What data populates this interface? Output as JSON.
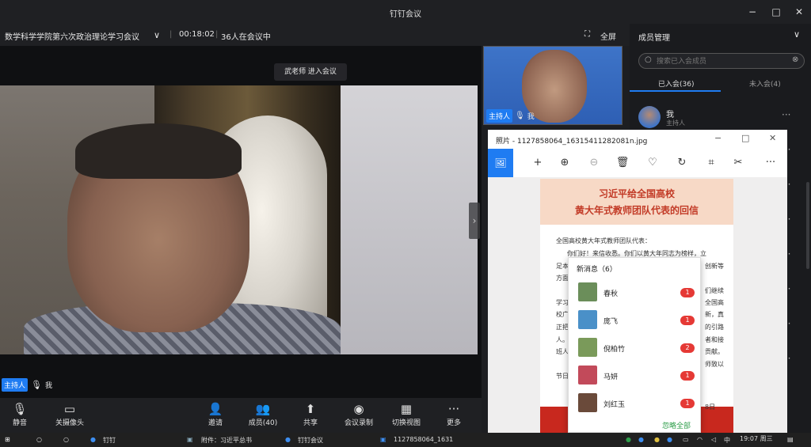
{
  "window": {
    "title": "钉钉会议",
    "min": "−",
    "max": "□",
    "close": "✕"
  },
  "meeting": {
    "name": "数学科学学院第六次政治理论学习会议",
    "duration": "00:18:02",
    "attendee_status": "36人在会议中",
    "fullscreen": "全屏"
  },
  "toast": "武老师 进入会议",
  "self_label": {
    "role": "主持人",
    "name": "我"
  },
  "thumb_label": {
    "role": "主持人",
    "name": "我"
  },
  "toolbar": [
    {
      "key": "mute",
      "label": "静音",
      "icon": "🎙"
    },
    {
      "key": "camera",
      "label": "关摄像头",
      "icon": "▭"
    },
    {
      "key": "invite",
      "label": "邀请",
      "icon": "👤"
    },
    {
      "key": "members",
      "label": "成员(40)",
      "icon": "👥"
    },
    {
      "key": "share",
      "label": "共享",
      "icon": "⬆"
    },
    {
      "key": "record",
      "label": "会议录制",
      "icon": "◉"
    },
    {
      "key": "view",
      "label": "切换视图",
      "icon": "▦"
    },
    {
      "key": "more",
      "label": "更多",
      "icon": "···"
    }
  ],
  "members_panel": {
    "title": "成员管理",
    "search_placeholder": "搜索已入会成员",
    "tab_joined": "已入会(36)",
    "tab_notjoined": "未入会(4)",
    "me_name": "我",
    "me_role": "主持人"
  },
  "photos": {
    "title": "照片 - 1127858064_16315411282081n.jpg",
    "tools": [
      "🖼",
      "+",
      "⊕",
      "⊖",
      "🗑",
      "♡",
      "↻",
      "⌗",
      "✂",
      "···"
    ]
  },
  "letter": {
    "heading1": "习近平给全国高校",
    "heading2": "黄大年式教师团队代表的回信",
    "salutation": "全国高校黄大年式教师团队代表：",
    "line1": "你们好！来信收悉。你们以黄大年同志为榜样，立",
    "line2": "足本",
    "line2b": "创新等",
    "line3": "方面",
    "line4": "学习",
    "line4b": "们继续",
    "line5": "校广",
    "line5b": "全国高",
    "line6": "正把",
    "line6b": "新，真",
    "line7": "人。",
    "line7b": "的引路",
    "line8": "班人",
    "line8b": "者和接",
    "line9": "节日",
    "line9b": "贡献。",
    "line10b": "8日",
    "line11b": "师致以"
  },
  "notifications": {
    "title": "新消息（6）",
    "dismiss": "忽略全部",
    "items": [
      {
        "name": "春秋",
        "count": "1",
        "color": "#6b8e5a"
      },
      {
        "name": "庞飞",
        "count": "1",
        "color": "#4a90c8"
      },
      {
        "name": "倪柏竹",
        "count": "2",
        "color": "#7a9a5a"
      },
      {
        "name": "马妍",
        "count": "1",
        "color": "#c24a5a"
      },
      {
        "name": "刘红玉",
        "count": "1",
        "color": "#6a4a3a"
      }
    ]
  },
  "taskbar": {
    "app1": "钉钉",
    "app2": "附件：习近平总书",
    "app3": "钉钉会议",
    "app4": "1127858064_1631",
    "time": "19:07 周三",
    "ime": "中"
  }
}
